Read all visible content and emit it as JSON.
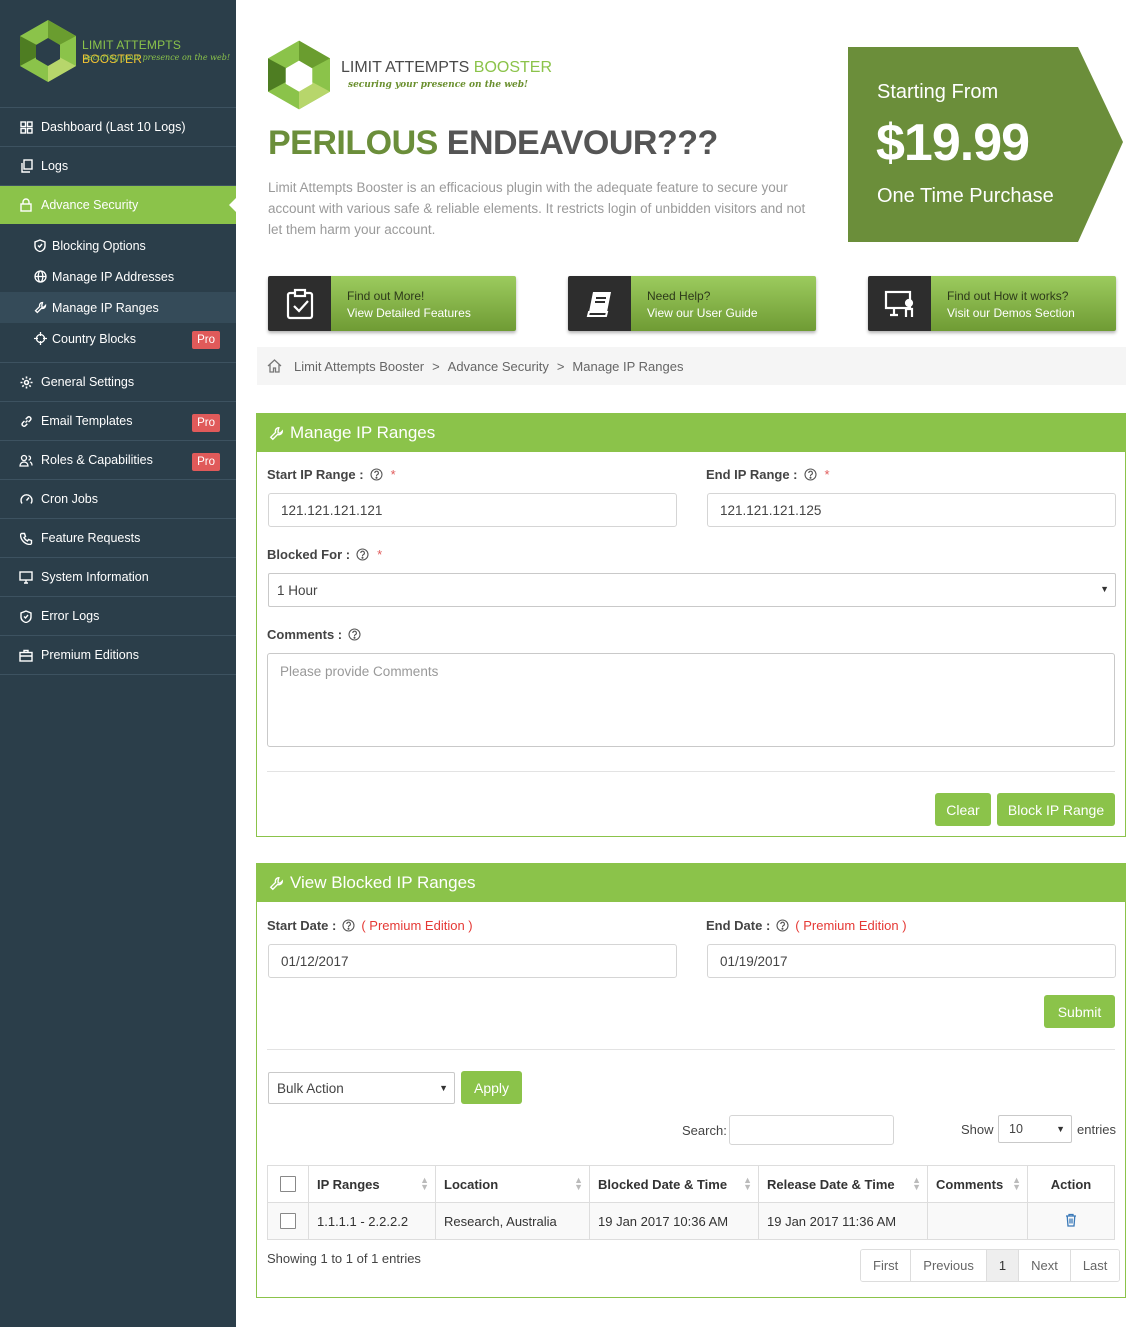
{
  "sidebar": {
    "brand_a": "LIMIT ATTEMPTS",
    "brand_b": "BOOSTER",
    "tagline": "securing your presence on the web!",
    "items": [
      {
        "label": "Dashboard (Last 10 Logs)",
        "icon": "grid-icon"
      },
      {
        "label": "Logs",
        "icon": "copy-icon"
      },
      {
        "label": "Advance Security",
        "icon": "lock-icon"
      },
      {
        "label": "General Settings",
        "icon": "gear-icon"
      },
      {
        "label": "Email Templates",
        "icon": "link-icon",
        "badge": "Pro"
      },
      {
        "label": "Roles & Capabilities",
        "icon": "users-icon",
        "badge": "Pro"
      },
      {
        "label": "Cron Jobs",
        "icon": "gauge-icon"
      },
      {
        "label": "Feature Requests",
        "icon": "phone-icon"
      },
      {
        "label": "System Information",
        "icon": "monitor-icon"
      },
      {
        "label": "Error Logs",
        "icon": "shield-icon"
      },
      {
        "label": "Premium Editions",
        "icon": "briefcase-icon"
      }
    ],
    "sub_items": [
      {
        "label": "Blocking Options",
        "icon": "shield-icon"
      },
      {
        "label": "Manage IP Addresses",
        "icon": "globe-icon"
      },
      {
        "label": "Manage IP Ranges",
        "icon": "wrench-icon"
      },
      {
        "label": "Country Blocks",
        "icon": "crosshair-icon",
        "badge": "Pro"
      }
    ]
  },
  "banner": {
    "brand_a": "LIMIT ATTEMPTS",
    "brand_b": "BOOSTER",
    "tagline": "securing your presence on the web!",
    "headline_a": "PERILOUS",
    "headline_b": "ENDEAVOUR???",
    "blurb": "Limit Attempts Booster is an efficacious plugin with the adequate feature to secure your account with various safe & reliable elements. It restricts login of unbidden visitors and not let them harm your account.",
    "price_label": "Starting From",
    "price": "$19.99",
    "price_note": "One Time Purchase",
    "price_color": "#6b8e3a"
  },
  "cta": [
    {
      "line1": "Find out More!",
      "line2": "View Detailed Features"
    },
    {
      "line1": "Need Help?",
      "line2": "View our User Guide"
    },
    {
      "line1": "Find out How it works?",
      "line2": "Visit our Demos Section"
    }
  ],
  "breadcrumb": {
    "items": [
      "Limit Attempts Booster",
      "Advance Security",
      "Manage IP Ranges"
    ],
    "sep": ">"
  },
  "manage": {
    "title": "Manage IP Ranges",
    "start_label": "Start IP Range :",
    "start_value": "121.121.121.121",
    "end_label": "End IP Range :",
    "end_value": "121.121.121.125",
    "blocked_label": "Blocked For :",
    "blocked_value": "1 Hour",
    "comments_label": "Comments :",
    "comments_placeholder": "Please provide Comments",
    "required": "*",
    "clear": "Clear",
    "block": "Block IP Range"
  },
  "view": {
    "title": "View Blocked IP Ranges",
    "start_label": "Start Date :",
    "end_label": "End Date :",
    "premium": "( Premium Edition )",
    "start_value": "01/12/2017",
    "end_value": "01/19/2017",
    "submit": "Submit",
    "bulk": "Bulk Action",
    "apply": "Apply",
    "search_label": "Search:",
    "show_label": "Show",
    "show_value": "10",
    "entries_label": "entries",
    "columns": [
      "IP Ranges",
      "Location",
      "Blocked Date & Time",
      "Release Date & Time",
      "Comments",
      "Action"
    ],
    "rows": [
      {
        "range": "1.1.1.1 - 2.2.2.2",
        "location": "Research, Australia",
        "blocked": "19 Jan 2017 10:36 AM",
        "release": "19 Jan 2017 11:36 AM",
        "comments": ""
      }
    ],
    "showing": "Showing 1 to 1 of 1 entries",
    "pager": [
      "First",
      "Previous",
      "1",
      "Next",
      "Last"
    ]
  },
  "colors": {
    "accent": "#8bc34a",
    "sidebar": "#2b3e4a",
    "pro": "#e05a5a"
  }
}
